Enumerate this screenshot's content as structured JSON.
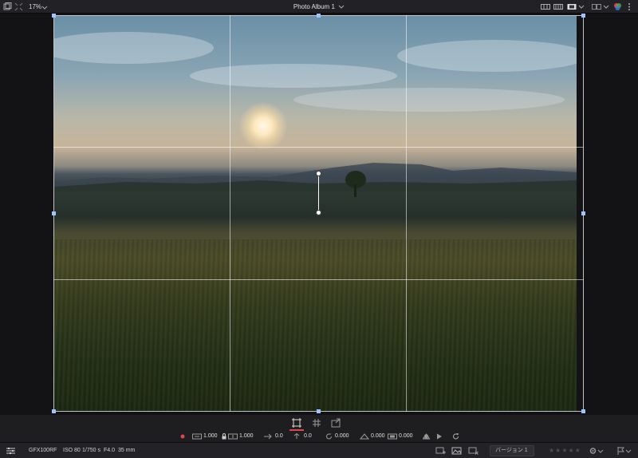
{
  "topbar": {
    "zoom": "17%",
    "album_title": "Photo Album 1"
  },
  "crop": {
    "active_tool": "crop-frame-tool",
    "aspect_width": "1.000",
    "aspect_height": "1.000",
    "position_x": "0.0",
    "position_y": "0.0",
    "rotation": "0.000",
    "flip_h": "0.000",
    "flip_v": "0.000"
  },
  "status": {
    "camera": "GFX100RF",
    "iso": "ISO 80",
    "shutter": "1/750 s",
    "aperture": "F4.0",
    "focal_length": "35 mm",
    "version": "バージョン 1",
    "rating_stars": "★★★★★",
    "rating": 0
  },
  "colors": {
    "accent_red": "#e0444c",
    "handle_blue": "#9ec3ff"
  }
}
